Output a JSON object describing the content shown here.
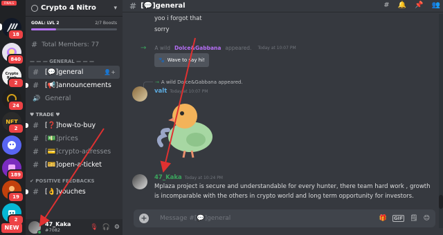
{
  "servers": {
    "top_badge": "FINALS",
    "items": [
      {
        "abbr": "",
        "badge": "18",
        "color": "#111827"
      },
      {
        "abbr": "",
        "badge": "840",
        "color": "#e7e3ee"
      },
      {
        "abbr": "Crypto Rank",
        "badge": "2",
        "color": "#f2f2f2"
      },
      {
        "abbr": "",
        "badge": "24",
        "color": "#1f1f1f"
      },
      {
        "abbr": "NFT",
        "badge": "2",
        "color": "#2b2b2b"
      },
      {
        "abbr": "",
        "badge": "",
        "color": "#5865f2"
      },
      {
        "abbr": "",
        "badge": "189",
        "color": "#7b2cbf"
      },
      {
        "abbr": "",
        "badge": "19",
        "color": "#c2410c"
      },
      {
        "abbr": "",
        "badge": "2",
        "color": "#06b6d4"
      }
    ],
    "new_label": "NEW"
  },
  "server": {
    "name": "Crypto 4 Nitro",
    "goal_label": "GOAL: LVL 2",
    "boosts": "2/7 Boosts",
    "goal_progress": 0.29,
    "total_members": "Total Members: 77"
  },
  "categories": {
    "general": "— — — GENERAL — — —",
    "trade": "♥ TRADE ♥",
    "feedbacks": "✔ POSITIVE FEEDBACKS"
  },
  "channels": {
    "general": "[💬]general",
    "announcements": "[📢]announcements",
    "general2": "General",
    "how_to_buy": "[❓]how-to-buy",
    "prices": "[💵]prices",
    "crypto_adresses": "[💳]crypto-adresses",
    "open_a_ticket": "[🎫]open-a-ticket",
    "vouches": "[👌]vouches"
  },
  "user": {
    "name": "47_Kaka",
    "tag": "#7082"
  },
  "chat": {
    "channel_title": "[💬]general",
    "line1": "yoo i forgot that",
    "line2": "sorry",
    "sys_prefix": "A wild",
    "sys_name": "Dolce&Gabbana",
    "sys_suffix": "appeared.",
    "sys_time": "Today at 10:07 PM",
    "wave_label": "Wave to say hi!",
    "reply_text": "A wild Dolce&Gabbana appeared.",
    "author1": "valt",
    "author1_color": "#5dade2",
    "author1_time": "Today at 10:07 PM",
    "author2": "47_Kaka",
    "author2_color": "#3ba55d",
    "author2_time": "Today at 10:24 PM",
    "message": "Mplaza project is secure and understandable for every hunter, there team hard work , growth is incomparable with the others in crypto world and long term opportunity for investors.",
    "composer_placeholder": "Message #[💬]general"
  }
}
